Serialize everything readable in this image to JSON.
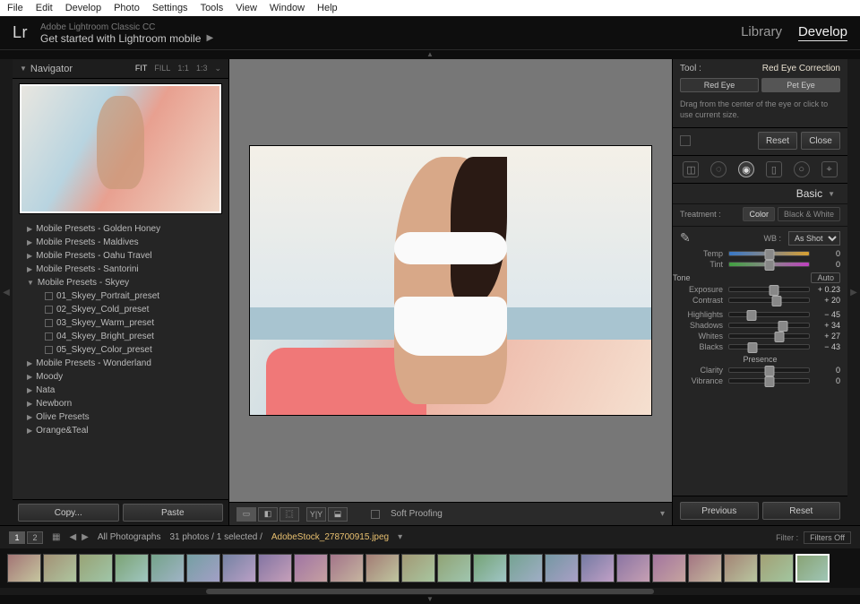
{
  "menu": [
    "File",
    "Edit",
    "Develop",
    "Photo",
    "Settings",
    "Tools",
    "View",
    "Window",
    "Help"
  ],
  "identity": {
    "logo": "Lr",
    "subtitle": "Adobe Lightroom Classic CC",
    "headline": "Get started with Lightroom mobile"
  },
  "modules": {
    "library": "Library",
    "develop": "Develop"
  },
  "navigator": {
    "title": "Navigator",
    "opts": {
      "fit": "FIT",
      "fill": "FILL",
      "one": "1:1",
      "ratio": "1:3"
    }
  },
  "presets": {
    "folders_above": [
      "Mobile Presets - Golden Honey",
      "Mobile Presets - Maldives",
      "Mobile Presets - Oahu Travel",
      "Mobile Presets - Santorini"
    ],
    "open_folder": "Mobile Presets - Skyey",
    "items": [
      "01_Skyey_Portrait_preset",
      "02_Skyey_Cold_preset",
      "03_Skyey_Warm_preset",
      "04_Skyey_Bright_preset",
      "05_Skyey_Color_preset"
    ],
    "folders_below": [
      "Mobile Presets - Wonderland",
      "Moody",
      "Nata",
      "Newborn",
      "Olive Presets",
      "Orange&Teal"
    ]
  },
  "left_buttons": {
    "copy": "Copy...",
    "paste": "Paste"
  },
  "toolbar": {
    "soft_proof": "Soft Proofing"
  },
  "tool": {
    "label": "Tool :",
    "name": "Red Eye Correction",
    "tab_red": "Red Eye",
    "tab_pet": "Pet Eye",
    "hint": "Drag from the center of the eye or click to use current size.",
    "reset": "Reset",
    "close": "Close"
  },
  "basic": {
    "title": "Basic",
    "treat_label": "Treatment :",
    "treat_color": "Color",
    "treat_bw": "Black & White",
    "wb_label": "WB :",
    "wb_value": "As Shot",
    "temp": "Temp",
    "tint": "Tint",
    "tone": "Tone",
    "auto": "Auto",
    "exposure": {
      "l": "Exposure",
      "v": "+ 0.23",
      "p": "56%"
    },
    "contrast": {
      "l": "Contrast",
      "v": "+ 20",
      "p": "60%"
    },
    "highlights": {
      "l": "Highlights",
      "v": "− 45",
      "p": "28%"
    },
    "shadows": {
      "l": "Shadows",
      "v": "+ 34",
      "p": "67%"
    },
    "whites": {
      "l": "Whites",
      "v": "+ 27",
      "p": "63%"
    },
    "blacks": {
      "l": "Blacks",
      "v": "− 43",
      "p": "29%"
    },
    "presence": "Presence",
    "clarity": {
      "l": "Clarity",
      "v": "0",
      "p": "50%"
    },
    "vibrance": {
      "l": "Vibrance",
      "v": "0",
      "p": "50%"
    }
  },
  "history_buttons": {
    "prev": "Previous",
    "reset": "Reset"
  },
  "filmstrip": {
    "page1": "1",
    "page2": "2",
    "collection": "All Photographs",
    "count": "31 photos / 1 selected /",
    "file": "AdobeStock_278700915.jpeg",
    "filter_label": "Filter :",
    "filter_value": "Filters Off",
    "thumbs": 23
  }
}
